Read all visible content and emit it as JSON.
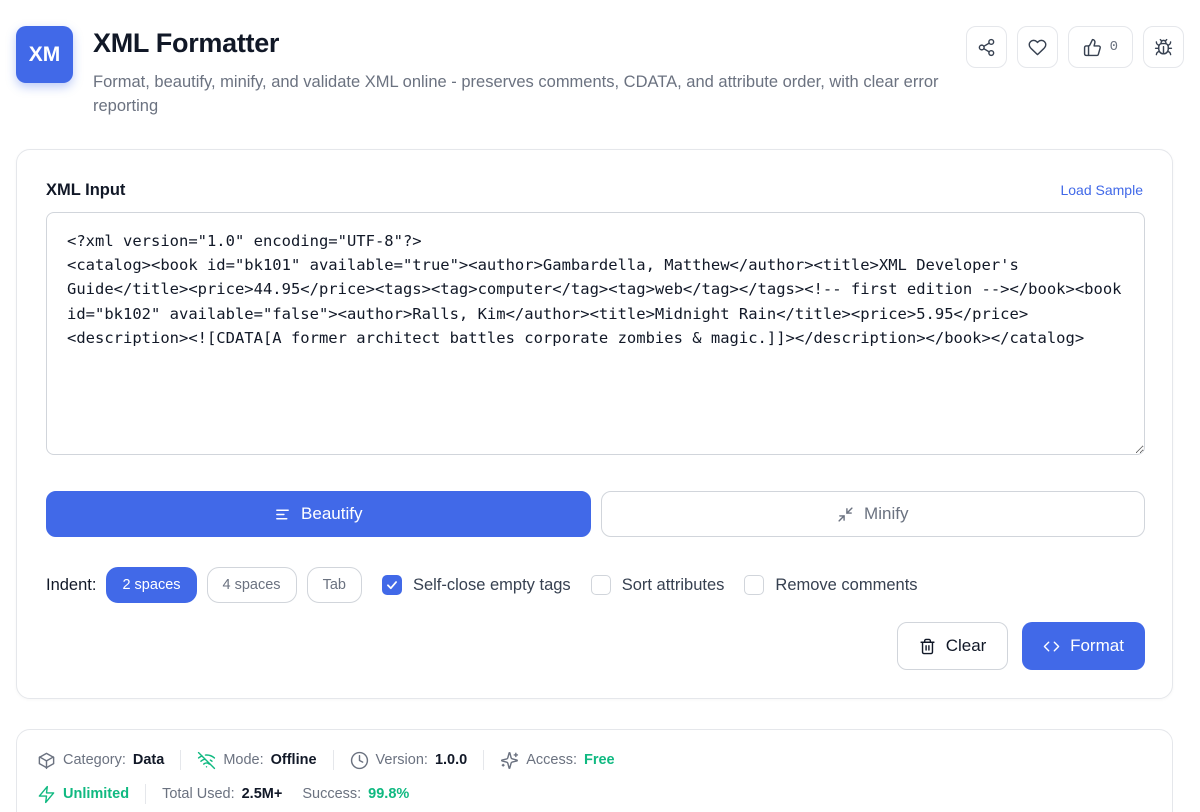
{
  "header": {
    "logo_text": "XM",
    "title": "XML Formatter",
    "description": "Format, beautify, minify, and validate XML online - preserves comments, CDATA, and attribute order, with clear error reporting",
    "like_count": "0",
    "icons": [
      "share-icon",
      "heart-icon",
      "thumbs-up-icon",
      "bug-icon"
    ]
  },
  "editor": {
    "label": "XML Input",
    "load_sample_label": "Load Sample",
    "value": "<?xml version=\"1.0\" encoding=\"UTF-8\"?>\n<catalog><book id=\"bk101\" available=\"true\"><author>Gambardella, Matthew</author><title>XML Developer's Guide</title><price>44.95</price><tags><tag>computer</tag><tag>web</tag></tags><!-- first edition --></book><book id=\"bk102\" available=\"false\"><author>Ralls, Kim</author><title>Midnight Rain</title><price>5.95</price><description><![CDATA[A former architect battles corporate zombies & magic.]]></description></book></catalog>"
  },
  "modes": {
    "beautify_label": "Beautify",
    "minify_label": "Minify",
    "selected": "Beautify"
  },
  "options": {
    "indent_label": "Indent:",
    "indent_options": [
      "2 spaces",
      "4 spaces",
      "Tab"
    ],
    "indent_selected": "2 spaces",
    "self_close_label": "Self-close empty tags",
    "self_close_checked": true,
    "sort_attrs_label": "Sort attributes",
    "sort_attrs_checked": false,
    "remove_comments_label": "Remove comments",
    "remove_comments_checked": false
  },
  "actions": {
    "clear_label": "Clear",
    "format_label": "Format"
  },
  "info": {
    "category_key": "Category:",
    "category_val": "Data",
    "mode_key": "Mode:",
    "mode_val": "Offline",
    "version_key": "Version:",
    "version_val": "1.0.0",
    "access_key": "Access:",
    "access_val": "Free",
    "unlimited_label": "Unlimited",
    "total_used_key": "Total Used:",
    "total_used_val": "2.5M+",
    "success_key": "Success:",
    "success_val": "99.8%"
  },
  "colors": {
    "accent": "#4169e8",
    "success": "#10b981",
    "border": "#e5e7eb",
    "muted_text": "#6b7280"
  }
}
